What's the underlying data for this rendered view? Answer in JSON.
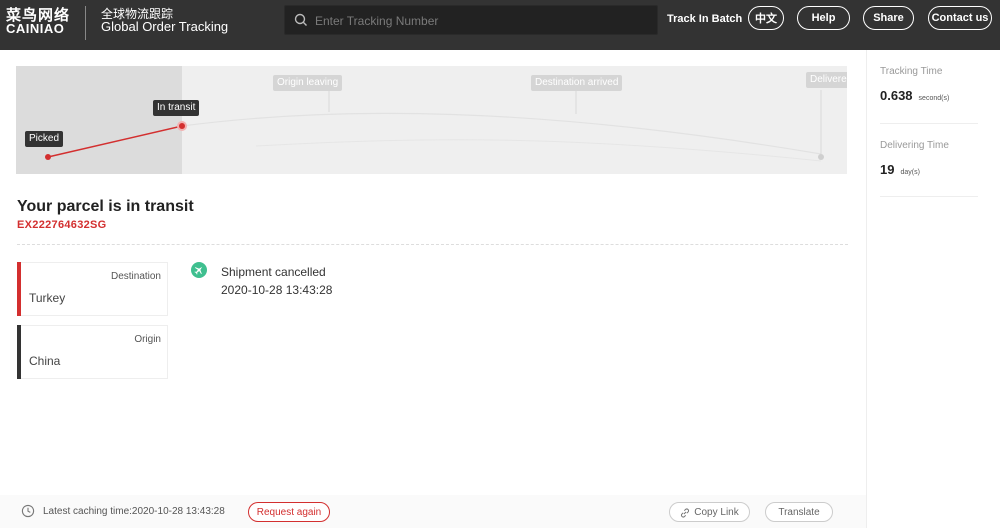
{
  "header": {
    "logo_cn": "菜鸟网络",
    "logo_en": "CAINIAO",
    "subtitle_cn": "全球物流跟踪",
    "subtitle_en": "Global Order Tracking",
    "search_placeholder": "Enter Tracking Number",
    "track_in_batch": "Track In Batch",
    "lang_button": "中文",
    "help_button": "Help",
    "share_button": "Share",
    "contact_button": "Contact us"
  },
  "progress": {
    "stages": [
      "Picked",
      "In transit",
      "Origin leaving",
      "Destination arrived",
      "Delivere"
    ],
    "current_stage": "In transit",
    "accent": "#d32f2f"
  },
  "parcel": {
    "status_title": "Your parcel is in transit",
    "tracking_number": "EX222764632SG"
  },
  "places": {
    "destination_label": "Destination",
    "destination_value": "Turkey",
    "origin_label": "Origin",
    "origin_value": "China"
  },
  "event": {
    "icon": "airplane-icon",
    "status": "Shipment cancelled",
    "time": "2020-10-28 13:43:28"
  },
  "footer": {
    "cache_text": "Latest caching time:2020-10-28 13:43:28",
    "request_again": "Request again",
    "copy_link": "Copy Link",
    "translate": "Translate"
  },
  "stats": {
    "tracking_time_label": "Tracking Time",
    "tracking_time_value": "0.638",
    "tracking_time_unit": "second(s)",
    "delivering_time_label": "Delivering Time",
    "delivering_time_value": "19",
    "delivering_time_unit": "day(s)"
  }
}
